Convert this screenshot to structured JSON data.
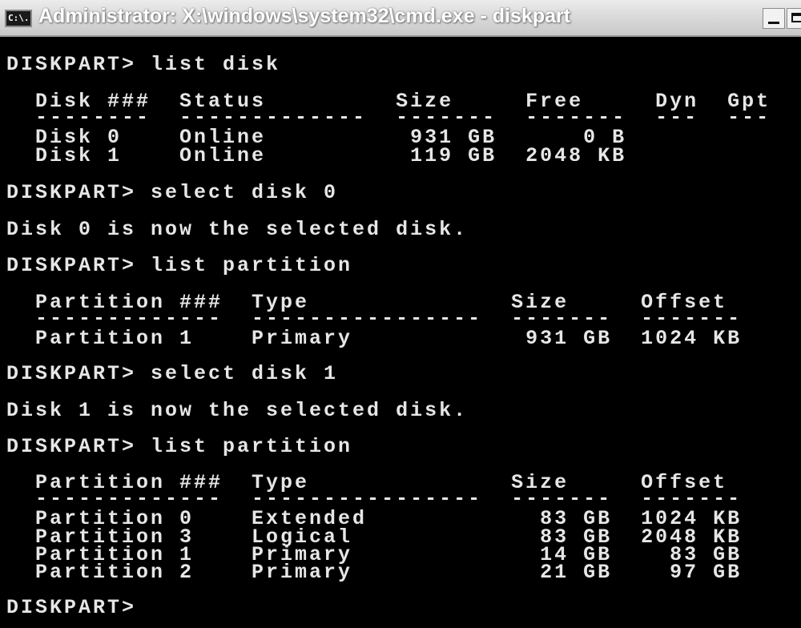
{
  "window": {
    "icon_text": "C:\\.",
    "title": "Administrator: X:\\windows\\system32\\cmd.exe - diskpart"
  },
  "console": {
    "lines": [
      "DISKPART> list disk",
      "  Disk ###  Status         Size     Free     Dyn  Gpt",
      "  --------  -------------  -------  -------  ---  ---",
      "  Disk 0    Online          931 GB      0 B",
      "  Disk 1    Online          119 GB  2048 KB",
      "DISKPART> select disk 0",
      "Disk 0 is now the selected disk.",
      "DISKPART> list partition",
      "  Partition ###  Type              Size     Offset",
      "  -------------  ----------------  -------  -------",
      "  Partition 1    Primary            931 GB  1024 KB",
      "DISKPART> select disk 1",
      "Disk 1 is now the selected disk.",
      "DISKPART> list partition",
      "  Partition ###  Type              Size     Offset",
      "  -------------  ----------------  -------  -------",
      "  Partition 0    Extended            83 GB  1024 KB",
      "  Partition 3    Logical             83 GB  2048 KB",
      "  Partition 1    Primary             14 GB    83 GB",
      "  Partition 2    Primary             21 GB    97 GB",
      "DISKPART>"
    ]
  }
}
